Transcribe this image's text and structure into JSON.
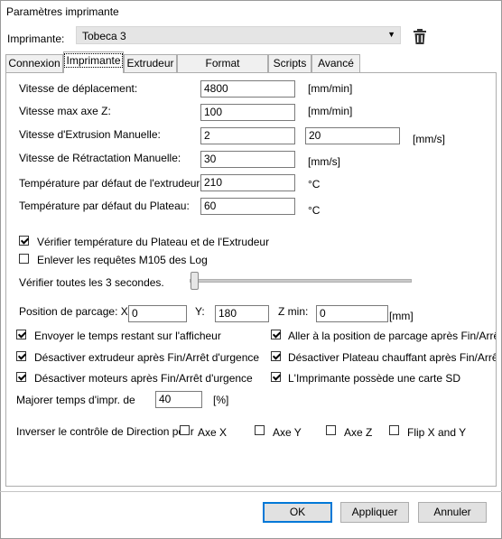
{
  "window": {
    "title": "Paramètres imprimante"
  },
  "printer": {
    "label": "Imprimante:",
    "selected": "Tobeca 3"
  },
  "tabs": [
    {
      "label": "Connexion"
    },
    {
      "label": "Imprimante"
    },
    {
      "label": "Extrudeur"
    },
    {
      "label": "Format imprimante"
    },
    {
      "label": "Scripts"
    },
    {
      "label": "Avancé"
    }
  ],
  "speeds": {
    "travel": {
      "label": "Vitesse de déplacement:",
      "value": "4800",
      "unit": "[mm/min]"
    },
    "zmax": {
      "label": "Vitesse max axe Z:",
      "value": "100",
      "unit": "[mm/min]"
    },
    "manual_extrude": {
      "label": "Vitesse d'Extrusion Manuelle:",
      "value1": "2",
      "value2": "20",
      "unit": "[mm/s]"
    },
    "manual_retract": {
      "label": "Vitesse de Rétractation Manuelle:",
      "value": "30",
      "unit": "[mm/s]"
    },
    "extruder_temp": {
      "label": "Température par défaut de l'extrudeur:",
      "value": "210",
      "unit": "°C"
    },
    "bed_temp": {
      "label": "Température par défaut du Plateau:",
      "value": "60",
      "unit": "°C"
    }
  },
  "checks": {
    "verify_temp": {
      "label": "Vérifier température du Plateau et de l'Extrudeur",
      "checked": true
    },
    "remove_m105": {
      "label": "Enlever les requêtes M105 des Log",
      "checked": false
    }
  },
  "interval": {
    "label": "Vérifier toutes les 3 secondes."
  },
  "park": {
    "label": "Position de parcage: X:",
    "x": "0",
    "y_label": "Y:",
    "y": "180",
    "zmin_label": "Z min:",
    "zmin": "0",
    "unit": "[mm]"
  },
  "options_left": [
    {
      "label": "Envoyer le temps restant sur l'afficheur",
      "checked": true
    },
    {
      "label": "Désactiver extrudeur après Fin/Arrêt d'urgence",
      "checked": true
    },
    {
      "label": "Désactiver moteurs après Fin/Arrêt d'urgence",
      "checked": true
    }
  ],
  "options_right": [
    {
      "label": "Aller à la position de parcage après Fin/Arrêt d'urg",
      "checked": true
    },
    {
      "label": "Désactiver Plateau chauffant après Fin/Arrêt d'ur",
      "checked": true
    },
    {
      "label": "L'Imprimante possède une carte SD",
      "checked": true
    }
  ],
  "time_boost": {
    "label": "Majorer temps d'impr. de",
    "value": "40",
    "unit": "[%]"
  },
  "direction": {
    "label": "Inverser le contrôle de Direction pour",
    "items": [
      {
        "label": "Axe X",
        "checked": false
      },
      {
        "label": "Axe Y",
        "checked": false
      },
      {
        "label": "Axe Z",
        "checked": false
      },
      {
        "label": "Flip X and Y",
        "checked": false
      }
    ]
  },
  "buttons": {
    "ok": "OK",
    "apply": "Appliquer",
    "cancel": "Annuler"
  }
}
